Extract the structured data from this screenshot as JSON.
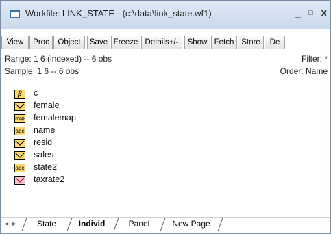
{
  "window": {
    "title": "Workfile: LINK_STATE - (c:\\data\\link_state.wf1)",
    "controls": {
      "minimize": "_",
      "maximize": "□",
      "close": "X"
    }
  },
  "toolbar": {
    "buttons": [
      "View",
      "Proc",
      "Object",
      "Save",
      "Freeze",
      "Details+/-",
      "Show",
      "Fetch",
      "Store",
      "De"
    ]
  },
  "info": {
    "range": "Range:  1 6 (indexed)  --  6 obs",
    "sample": "Sample: 1 6  --  6 obs",
    "filter": "Filter: *",
    "order": "Order: Name"
  },
  "objects": [
    {
      "name": "c",
      "icon": "coef-icon"
    },
    {
      "name": "female",
      "icon": "series-icon"
    },
    {
      "name": "femalemap",
      "icon": "valmap-icon"
    },
    {
      "name": "name",
      "icon": "alpha-series-icon"
    },
    {
      "name": "resid",
      "icon": "series-icon"
    },
    {
      "name": "sales",
      "icon": "series-icon"
    },
    {
      "name": "state2",
      "icon": "alpha-series-icon"
    },
    {
      "name": "taxrate2",
      "icon": "link-series-icon"
    }
  ],
  "tabs": {
    "items": [
      "State",
      "Individ",
      "Panel",
      "New Page"
    ],
    "active": "Individ",
    "nav": "◄ ►"
  }
}
